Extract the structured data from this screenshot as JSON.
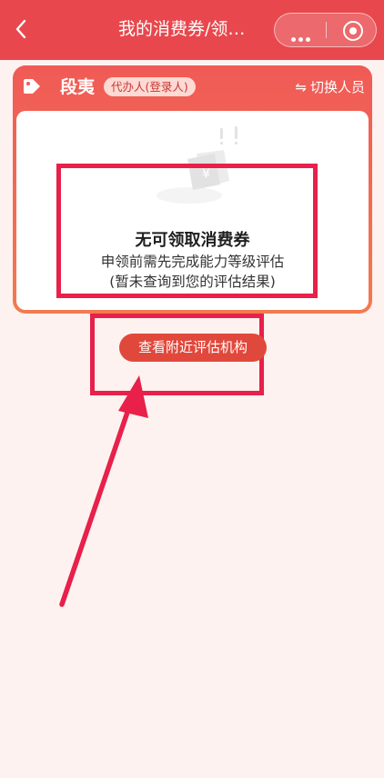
{
  "header": {
    "title": "我的消费券/领…",
    "back_icon": "chevron-left-icon",
    "more_icon": "more-dots-icon",
    "close_icon": "mini-program-close-icon",
    "background_color": "#e8484d"
  },
  "card": {
    "name": "段夷",
    "role_badge": "代办人(登录人)",
    "switch_label": "切换人员",
    "switch_icon": "⇋",
    "empty_state": {
      "illustration": "empty-coupon-icon",
      "title": "无可领取消费券",
      "line1": "申领前需先完成能力等级评估",
      "line2": "(暂未查询到您的评估结果)"
    }
  },
  "action": {
    "nearby_button": "查看附近评估机构"
  },
  "annotation_color": "#e8204a"
}
